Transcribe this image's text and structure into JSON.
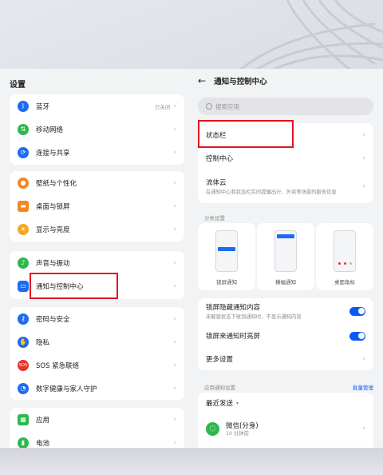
{
  "left": {
    "title": "设置",
    "groups": [
      [
        {
          "label": "蓝牙",
          "value": "已关闭",
          "icon": "bluetooth-icon",
          "color": "#1b6cf2"
        },
        {
          "label": "移动网络",
          "value": "",
          "icon": "mobile-network-icon",
          "color": "#2db84d"
        },
        {
          "label": "连接与共享",
          "value": "",
          "icon": "share-icon",
          "color": "#1b6cf2"
        }
      ],
      [
        {
          "label": "壁纸与个性化",
          "value": "",
          "icon": "wallpaper-icon",
          "color": "#f5861f"
        },
        {
          "label": "桌面与锁屏",
          "value": "",
          "icon": "desktop-icon",
          "color": "#f5861f"
        },
        {
          "label": "显示与亮度",
          "value": "",
          "icon": "brightness-icon",
          "color": "#f5a623"
        }
      ],
      [
        {
          "label": "声音与振动",
          "value": "",
          "icon": "sound-icon",
          "color": "#2db84d"
        },
        {
          "label": "通知与控制中心",
          "value": "",
          "icon": "notification-icon",
          "color": "#1b6cf2"
        }
      ],
      [
        {
          "label": "密码与安全",
          "value": "",
          "icon": "key-icon",
          "color": "#1b6cf2"
        },
        {
          "label": "隐私",
          "value": "",
          "icon": "privacy-icon",
          "color": "#1b6cf2"
        },
        {
          "label": "SOS 紧急联络",
          "value": "",
          "icon": "sos-icon",
          "color": "#e8332a"
        },
        {
          "label": "数字健康与家人守护",
          "value": "",
          "icon": "health-icon",
          "color": "#1b6cf2"
        }
      ],
      [
        {
          "label": "应用",
          "value": "",
          "icon": "apps-icon",
          "color": "#2db84d"
        },
        {
          "label": "电池",
          "value": "",
          "icon": "battery-icon",
          "color": "#2db84d"
        }
      ]
    ]
  },
  "right": {
    "back": "←",
    "title": "通知与控制中心",
    "search_placeholder": "搜索应用",
    "status_bar": "状态栏",
    "control_center": "控制中心",
    "liuti_title": "流体云",
    "liuti_desc": "在通知中心和状态栏实时提醒出行、外卖等场景的服务信息",
    "category_label": "分类设置",
    "thumbs": [
      "锁屏通知",
      "横幅通知",
      "桌面角标"
    ],
    "lock_hide_title": "锁屏隐藏通知内容",
    "lock_hide_desc": "未解锁状态下收到通知时，不显示通知内容",
    "lock_light_title": "锁屏来通知时亮屏",
    "more_settings": "更多设置",
    "app_notif_label": "应用通知设置",
    "batch_manage": "批量管理",
    "recent_sent": "最近发送",
    "wechat_name": "微信(分身)",
    "wechat_time": "10 分钟前"
  },
  "colors": {
    "accent": "#0a59f7",
    "highlight": "#e0141e"
  }
}
